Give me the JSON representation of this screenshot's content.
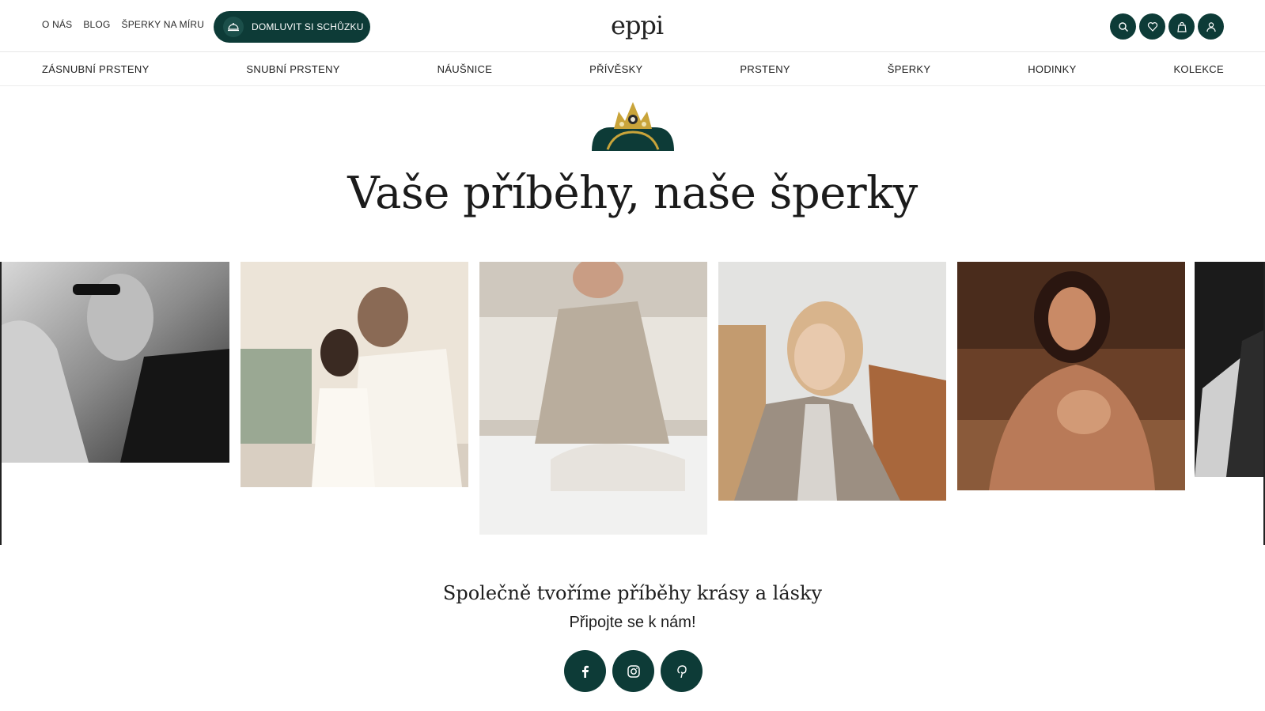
{
  "header": {
    "links": [
      "O NÁS",
      "BLOG",
      "ŠPERKY NA MÍRU"
    ],
    "cta_label": "DOMLUVIT SI SCHŮZKU",
    "logo": "eppi",
    "icons": [
      "search-icon",
      "heart-icon",
      "bag-icon",
      "user-icon"
    ]
  },
  "nav": {
    "items": [
      "ZÁSNUBNÍ PRSTENY",
      "SNUBNÍ PRSTENY",
      "NÁUŠNICE",
      "PŘÍVĚSKY",
      "PRSTENY",
      "ŠPERKY",
      "HODINKY",
      "KOLEKCE"
    ]
  },
  "main": {
    "title": "Vaše příběhy, naše šperky",
    "subtitle": "Společně tvoříme příběhy krásy a lásky",
    "subline": "Připojte se k nám!"
  },
  "social": [
    "facebook-icon",
    "instagram-icon",
    "pinterest-icon"
  ],
  "colors": {
    "brand": "#0d3b37",
    "gold": "#c9a43a"
  }
}
